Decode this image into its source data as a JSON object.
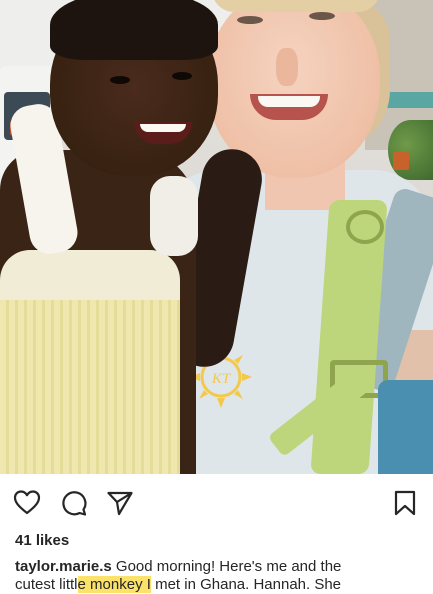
{
  "post": {
    "photo": {
      "alt_label": "",
      "shirt_logo_text": "KT"
    },
    "actions": {
      "like_icon": "heart-icon",
      "comment_icon": "comment-icon",
      "share_icon": "paper-plane-icon",
      "save_icon": "bookmark-icon"
    },
    "likes_text": "41 likes",
    "likes_count": 41,
    "caption": {
      "username": "taylor.marie.s",
      "text_part1": " Good morning! Here's me and the",
      "line2_part1": "cutest littl",
      "line2_highlight": "e monkey I",
      "line2_part2": " met in Ghana. Hannah. She"
    },
    "colors": {
      "highlight": "#fbe26a",
      "text": "#262626"
    }
  }
}
